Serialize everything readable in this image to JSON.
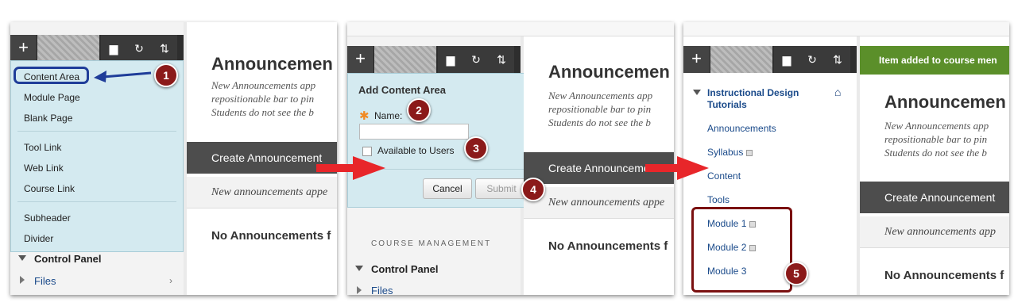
{
  "panel1": {
    "toolbar": {
      "plus": "+",
      "folder_icon": "folder-icon",
      "refresh_icon": "refresh-icon",
      "sort_icon": "sort-icon"
    },
    "dropdown": {
      "items": [
        "Content Area",
        "Module Page",
        "Blank Page",
        "Tool Link",
        "Web Link",
        "Course Link",
        "Subheader",
        "Divider"
      ]
    },
    "content": {
      "title": "Announcemen",
      "desc": [
        "New Announcements app",
        "repositionable bar to pin",
        "Students do not see the b"
      ],
      "create": "Create Announcement",
      "empty": "New announcements appe",
      "none": "No Announcements f"
    },
    "control_panel": "Control Panel",
    "files": "Files",
    "files_chevron": "›"
  },
  "panel2": {
    "toolbar": {
      "plus": "+"
    },
    "popup": {
      "title": "Add Content Area",
      "required_mark": "✱",
      "name_label": "Name:",
      "name_value": "",
      "available_label": "Available to Users",
      "cancel": "Cancel",
      "submit": "Submit"
    },
    "course_management": "COURSE MANAGEMENT",
    "control_panel": "Control Panel",
    "files": "Files",
    "content": {
      "title": "Announcemen",
      "desc": [
        "New Announcements app",
        "repositionable bar to pin",
        "Students do not see the b"
      ],
      "create": "Create Announceme",
      "empty": "New announcements appe",
      "none": "No Announcements f"
    }
  },
  "panel3": {
    "toolbar": {
      "plus": "+"
    },
    "course_title": "Instructional Design Tutorials",
    "menu": [
      "Announcements",
      "Syllabus",
      "Content",
      "Tools",
      "Module 1",
      "Module 2",
      "Module 3"
    ],
    "success": "Item added to course men",
    "content": {
      "title": "Announcemen",
      "desc": [
        "New Announcements app",
        "repositionable bar to pin",
        "Students do not see the b"
      ],
      "create": "Create Announcement",
      "empty": "New announcements app",
      "none": "No Announcements f"
    }
  },
  "callouts": [
    "1",
    "2",
    "3",
    "4",
    "5"
  ],
  "colors": {
    "callout": "#8b1a1a",
    "arrow": "#e8262a",
    "highlight_blue": "#1f3d99",
    "success_green": "#5b8f2a"
  }
}
